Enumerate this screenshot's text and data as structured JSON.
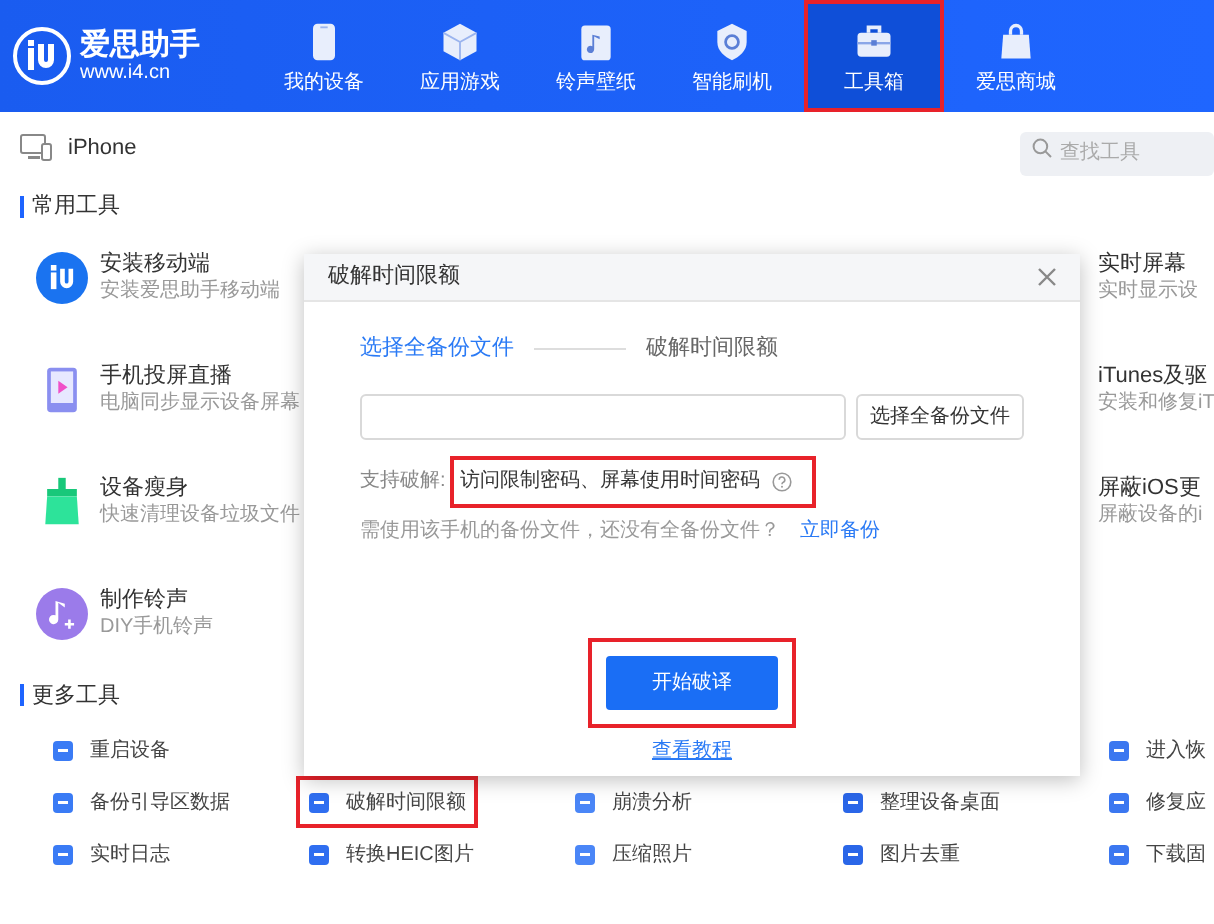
{
  "header": {
    "title": "爱思助手",
    "url": "www.i4.cn"
  },
  "nav": [
    {
      "label": "我的设备",
      "selected": false,
      "highlighted": false
    },
    {
      "label": "应用游戏",
      "selected": false,
      "highlighted": false
    },
    {
      "label": "铃声壁纸",
      "selected": false,
      "highlighted": false
    },
    {
      "label": "智能刷机",
      "selected": false,
      "highlighted": false
    },
    {
      "label": "工具箱",
      "selected": true,
      "highlighted": true
    },
    {
      "label": "爱思商城",
      "selected": false,
      "highlighted": false
    }
  ],
  "device": {
    "name": "iPhone"
  },
  "search": {
    "placeholder": "查找工具"
  },
  "common_tools": {
    "title": "常用工具",
    "left_items": [
      {
        "title": "安装移动端",
        "subtitle": "安装爱思助手移动端"
      },
      {
        "title": "手机投屏直播",
        "subtitle": "电脑同步显示设备屏幕"
      },
      {
        "title": "设备瘦身",
        "subtitle": "快速清理设备垃圾文件"
      },
      {
        "title": "制作铃声",
        "subtitle": "DIY手机铃声"
      }
    ],
    "right_items": [
      {
        "title": "实时屏幕",
        "subtitle": "实时显示设"
      },
      {
        "title": "iTunes及驱",
        "subtitle": "安装和修复iT"
      },
      {
        "title": "屏蔽iOS更",
        "subtitle": "屏蔽设备的i"
      }
    ]
  },
  "more_tools": {
    "title": "更多工具",
    "rows": [
      [
        {
          "label": "重启设备",
          "highlighted": false
        },
        null,
        null,
        null,
        {
          "label": "进入恢",
          "highlighted": false
        }
      ],
      [
        {
          "label": "备份引导区数据",
          "highlighted": false
        },
        {
          "label": "破解时间限额",
          "highlighted": true
        },
        {
          "label": "崩溃分析",
          "highlighted": false
        },
        {
          "label": "整理设备桌面",
          "highlighted": false
        },
        {
          "label": "修复应",
          "highlighted": false
        }
      ],
      [
        {
          "label": "实时日志",
          "highlighted": false
        },
        {
          "label": "转换HEIC图片",
          "highlighted": false
        },
        {
          "label": "压缩照片",
          "highlighted": false
        },
        {
          "label": "图片去重",
          "highlighted": false
        },
        {
          "label": "下载固",
          "highlighted": false
        }
      ]
    ]
  },
  "dialog": {
    "title": "破解时间限额",
    "steps": [
      {
        "label": "选择全备份文件",
        "selected": true
      },
      {
        "label": "破解时间限额",
        "selected": false
      }
    ],
    "browse_button": "选择全备份文件",
    "support": {
      "label": "支持破解:",
      "value": "访问限制密码、屏幕使用时间密码",
      "highlighted": true
    },
    "hint": {
      "text": "需使用该手机的备份文件，还没有全备份文件？",
      "link": "立即备份"
    },
    "start_button": {
      "label": "开始破译",
      "highlighted": true
    },
    "tutorial_link": "查看教程"
  }
}
